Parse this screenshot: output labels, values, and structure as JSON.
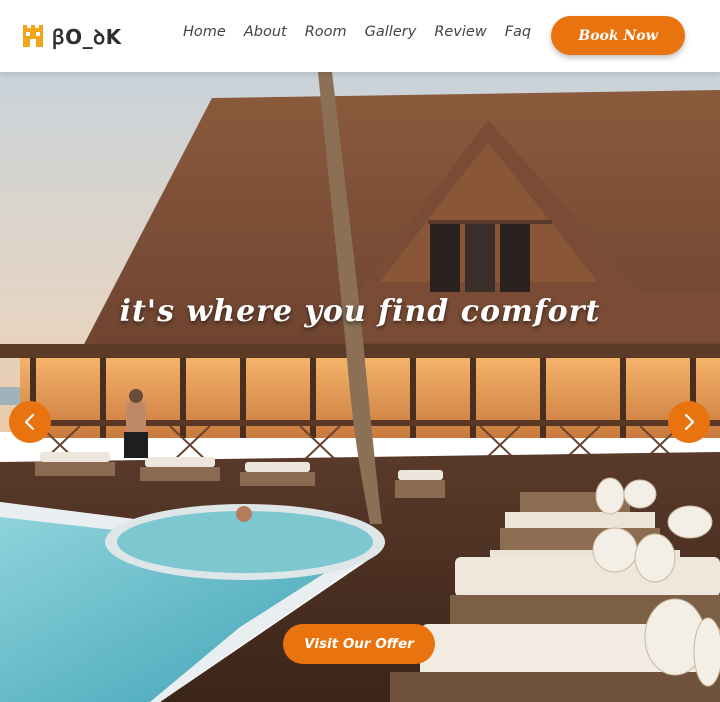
{
  "brand": {
    "name": "ꞵO_ꝺK",
    "icon": "hotel-building-icon",
    "accent_color": "#e8730f"
  },
  "nav": {
    "links": [
      {
        "label": "Home"
      },
      {
        "label": "About"
      },
      {
        "label": "Room"
      },
      {
        "label": "Gallery"
      },
      {
        "label": "Review"
      },
      {
        "label": "Faq"
      }
    ],
    "cta_label": "Book Now"
  },
  "hero": {
    "tagline": "it's where you find comfort",
    "offer_label": "Visit Our Offer",
    "prev_icon": "chevron-left-icon",
    "next_icon": "chevron-right-icon",
    "image": "resort-pool-lodge-photo"
  }
}
